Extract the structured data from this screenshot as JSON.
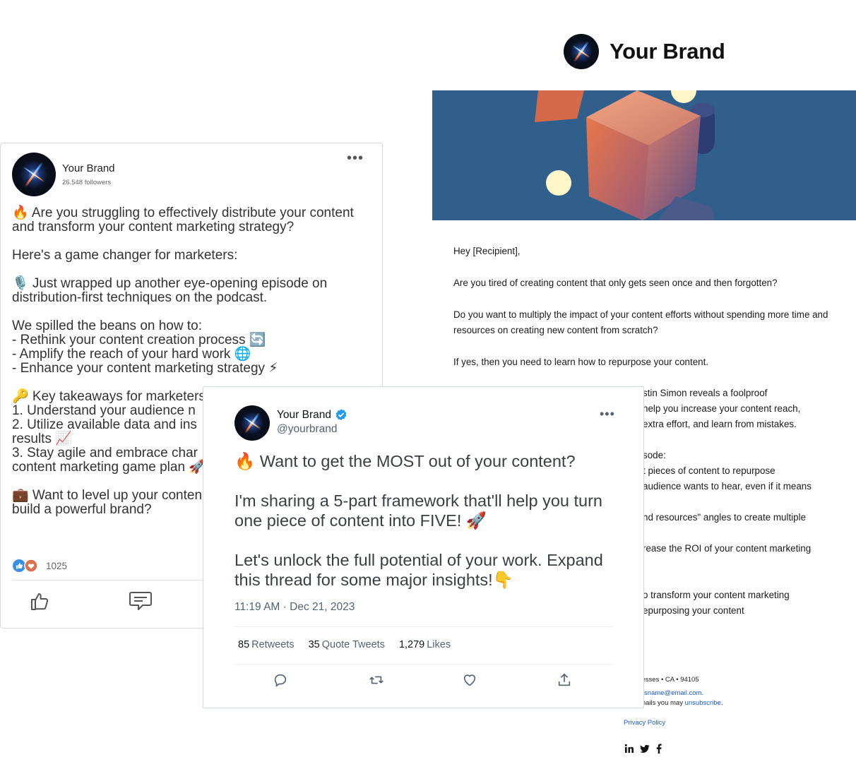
{
  "brand": {
    "name": "Your Brand"
  },
  "email": {
    "greeting": "Hey [Recipient],",
    "paragraphs": [
      "Are you tired of creating content that only gets seen once and then forgotten?",
      "Do you want to multiply the impact of your content efforts without spending more time and resources on creating new content from scratch?",
      "If yes, then you need to learn how to repurpose your content."
    ],
    "partial_lines": [
      "stin Simon reveals a foolproof",
      "help you increase your content reach,",
      "extra effort, and learn from mistakes.",
      "",
      "sode:",
      "t pieces of content to repurpose",
      "audience wants to hear, even if it means",
      "",
      "nd resources\" angles to create multiple",
      "",
      "rease the ROI of your content marketing",
      "",
      "",
      "o transform your content marketing",
      "epurposing your content"
    ],
    "footer": {
      "address": "• Addresses • CA • 94105",
      "email_link": "stomersname@email.com",
      "email_suffix": ".",
      "unsub_prefix": "ese emails you may ",
      "unsub_link": "unsubscribe",
      "unsub_suffix": ".",
      "privacy": "Privacy Policy"
    },
    "social_icons": [
      "linkedin-icon",
      "twitter-icon",
      "facebook-icon"
    ]
  },
  "linkedin": {
    "name": "Your Brand",
    "followers": "26.548 followers",
    "more": "•••",
    "paragraphs": [
      "🔥 Are you struggling to effectively distribute your content and transform your content marketing strategy?",
      "Here's a game changer for marketers:",
      "🎙️ Just wrapped up another eye-opening episode on distribution-first techniques on the podcast.",
      "We spilled the beans on how to:\n- Rethink your content creation process 🔄\n- Amplify the reach of your hard work 🌐\n- Enhance your content marketing strategy ⚡",
      "🔑 Key takeaways for marketers:\n1. Understand your audience n\n2. Utilize available data and ins\nresults 📈\n3. Stay agile and embrace char\ncontent marketing game plan 🚀",
      "💼 Want to level up your conten\nbuild a powerful brand?"
    ],
    "reaction_count": "1025",
    "accent": "#0a66c2"
  },
  "tweet": {
    "name": "Your Brand",
    "handle": "@yourbrand",
    "more": "•••",
    "paragraphs": [
      "🔥 Want to get the MOST out of your content?",
      "I'm sharing a 5-part framework that'll help you turn one piece of content into FIVE! 🚀",
      "Let's unlock the full potential of your work. Expand this thread for some major insights!👇"
    ],
    "time": "11:19 AM",
    "date": "Dec 21, 2023",
    "retweets": "85",
    "retweets_label": "Retweets",
    "quotes": "35",
    "quotes_label": "Quote Tweets",
    "likes": "1,279",
    "likes_label": "Likes",
    "verified_color": "#1d9bf0"
  }
}
